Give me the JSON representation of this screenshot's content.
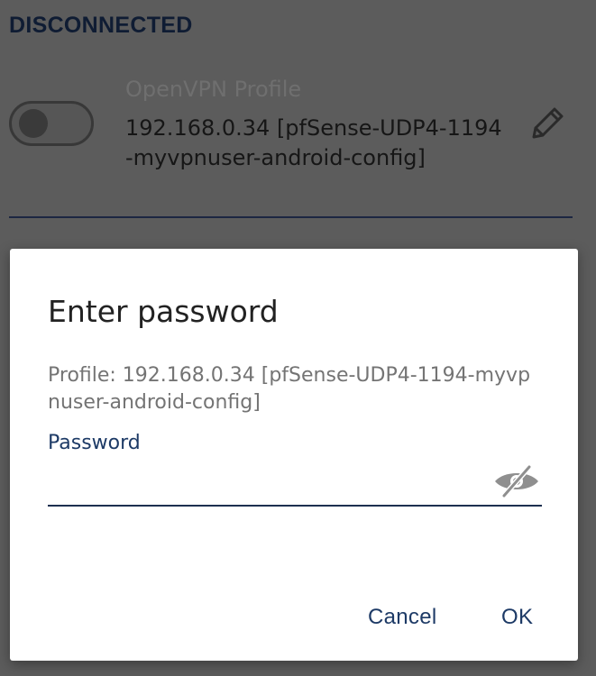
{
  "status": {
    "label": "DISCONNECTED"
  },
  "profile": {
    "type": "OpenVPN Profile",
    "name": "192.168.0.34 [pfSense-UDP4-1194\n-myvpnuser-android-config]",
    "toggle_on": false,
    "edit_icon": "pencil-icon"
  },
  "dialog": {
    "title": "Enter password",
    "message": "Profile: 192.168.0.34 [pfSense-UDP4-1194-myvpnuser-android-config]",
    "field_label": "Password",
    "password_value": "",
    "visibility_icon": "eye-off-icon",
    "cancel_label": "Cancel",
    "ok_label": "OK"
  },
  "colors": {
    "accent": "#1d3a66",
    "scrim": "#5c5c5c",
    "dialog_bg": "#ffffff"
  }
}
